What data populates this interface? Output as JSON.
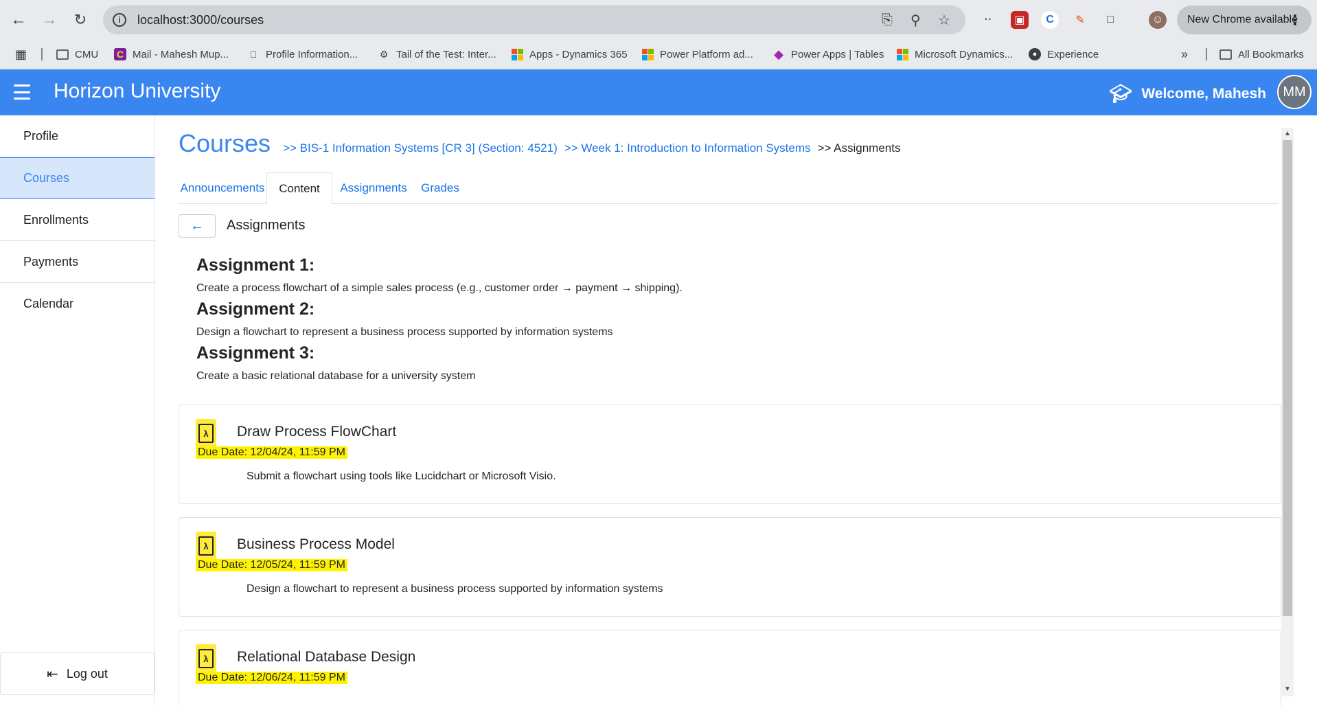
{
  "browser": {
    "url": "localhost:3000/courses",
    "new_chrome": "New Chrome available",
    "bookmarks": [
      {
        "label": "CMU"
      },
      {
        "label": "Mail - Mahesh Mup..."
      },
      {
        "label": "Profile Information..."
      },
      {
        "label": "Tail of the Test: Inter..."
      },
      {
        "label": "Apps - Dynamics 365"
      },
      {
        "label": "Power Platform ad..."
      },
      {
        "label": "Power Apps | Tables"
      },
      {
        "label": "Microsoft Dynamics..."
      },
      {
        "label": "Experience"
      },
      {
        "label": "All Bookmarks"
      }
    ]
  },
  "header": {
    "brand": "Horizon University",
    "welcome": "Welcome, Mahesh",
    "avatar_initials": "MM",
    "color": "#3a86f0"
  },
  "sidebar": {
    "items": [
      {
        "label": "Profile"
      },
      {
        "label": "Courses"
      },
      {
        "label": "Enrollments"
      },
      {
        "label": "Payments"
      },
      {
        "label": "Calendar"
      }
    ],
    "active": "Courses",
    "logout": "Log out"
  },
  "breadcrumb": {
    "title": "Courses",
    "course": ">> BIS-1 Information Systems [CR 3] (Section: 4521)",
    "week": ">> Week 1: Introduction to Information Systems",
    "current": ">> Assignments"
  },
  "tabs": [
    {
      "label": "Announcements"
    },
    {
      "label": "Content"
    },
    {
      "label": "Assignments"
    },
    {
      "label": "Grades"
    }
  ],
  "active_tab": "Content",
  "section_title": "Assignments",
  "assignments": [
    {
      "heading": "Assignment 1:",
      "description": "Create a process flowchart of a simple sales process (e.g., customer order → payment → shipping)."
    },
    {
      "heading": "Assignment 2:",
      "description": "Design a flowchart to represent a business process supported by information systems"
    },
    {
      "heading": "Assignment 3:",
      "description": "Create a basic relational database for a university system"
    }
  ],
  "cards": [
    {
      "title": "Draw Process FlowChart",
      "due": "Due Date: 12/04/24, 11:59 PM",
      "description": "Submit a flowchart using tools like Lucidchart or Microsoft Visio."
    },
    {
      "title": "Business Process Model",
      "due": "Due Date: 12/05/24, 11:59 PM",
      "description": "Design a flowchart to represent a business process supported by information systems"
    },
    {
      "title": "Relational Database Design",
      "due": "Due Date: 12/06/24, 11:59 PM",
      "description": ""
    }
  ]
}
